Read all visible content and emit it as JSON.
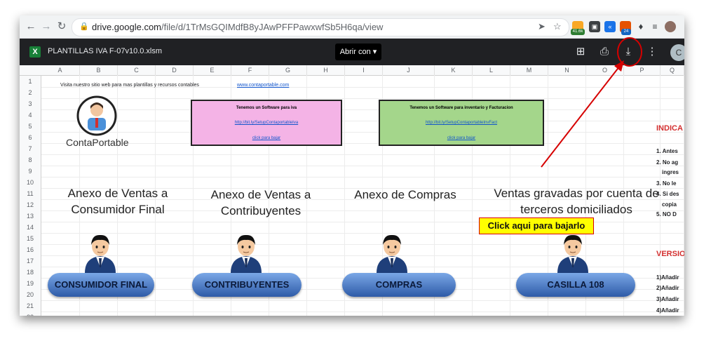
{
  "browser": {
    "url_host": "drive.google.com",
    "url_path": "/file/d/1TrMsGQIMdfB8yJAwPFFPawxwfSb5H6qa/view",
    "ext_badge_1": "41.6k",
    "ext_badge_2": "24"
  },
  "viewer": {
    "file_name": "PLANTILLAS IVA F-07v10.0.xlsm",
    "open_with": "Abrir con",
    "avatar_letter": "C"
  },
  "sheet": {
    "columns": [
      "A",
      "B",
      "C",
      "D",
      "E",
      "F",
      "G",
      "H",
      "I",
      "J",
      "K",
      "L",
      "M",
      "N",
      "O",
      "P",
      "Q"
    ],
    "rows": [
      "1",
      "2",
      "3",
      "4",
      "5",
      "6",
      "7",
      "8",
      "9",
      "10",
      "11",
      "12",
      "13",
      "14",
      "15",
      "16",
      "17",
      "18",
      "19",
      "20",
      "21",
      "22"
    ],
    "visit_text": "Visita nuestro sitio web para mas plantillas y recursos contables",
    "visit_link": "www.contaportable.com",
    "logo_name": "ContaPortable",
    "promo_iva": {
      "title": "Tenemos un Software para iva",
      "link": "http://bit.ly/SetupContaportableIva",
      "cta": "click para bajar"
    },
    "promo_inv": {
      "title": "Tenemos un Software para inventario y Facturacion",
      "link": "http://bit.ly/SetupContaportableInvFact",
      "cta": "click para bajar"
    },
    "sections": [
      {
        "title_l1": "Anexo de Ventas a",
        "title_l2": "Consumidor Final",
        "button": "CONSUMIDOR FINAL"
      },
      {
        "title_l1": "Anexo de Ventas a",
        "title_l2": "Contribuyentes",
        "button": "CONTRIBUYENTES"
      },
      {
        "title_l1": "Anexo de Compras",
        "title_l2": "",
        "button": "COMPRAS"
      },
      {
        "title_l1": "Ventas gravadas por cuenta de",
        "title_l2": "terceros domiciliados",
        "button": "CASILLA 108"
      }
    ],
    "side": {
      "heading1": "INDICA",
      "items": [
        "1. Antes",
        "2. No ag",
        "ingres",
        "3. No le",
        "4. Si des",
        "copia",
        "5.  NO D"
      ],
      "heading2": "VERSIO",
      "versions": [
        "1)Añadir",
        "2)Añadir",
        "3)Añadir",
        "4)Añadir"
      ]
    }
  },
  "annotation": {
    "callout": "Click aqui para bajarlo",
    "color": "#d60000"
  }
}
